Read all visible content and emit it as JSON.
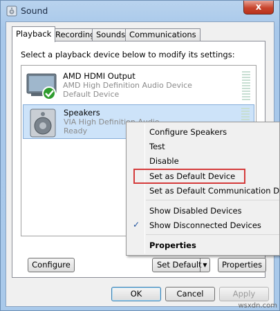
{
  "window": {
    "title": "Sound",
    "close_label": "x"
  },
  "tabs": [
    {
      "label": "Playback",
      "active": true
    },
    {
      "label": "Recording",
      "active": false
    },
    {
      "label": "Sounds",
      "active": false
    },
    {
      "label": "Communications",
      "active": false
    }
  ],
  "instruction": "Select a playback device below to modify its settings:",
  "devices": [
    {
      "name": "AMD HDMI Output",
      "description": "AMD High Definition Audio Device",
      "status": "Default Device",
      "icon": "monitor-icon",
      "default_badge": "check-badge-icon",
      "selected": false
    },
    {
      "name": "Speakers",
      "description": "VIA High Definition Audio",
      "status": "Ready",
      "icon": "speaker-icon",
      "selected": true
    }
  ],
  "panel_buttons": {
    "configure": "Configure",
    "set_default": "Set Default",
    "properties": "Properties"
  },
  "context_menu": {
    "items": [
      {
        "label": "Configure Speakers"
      },
      {
        "label": "Test"
      },
      {
        "label": "Disable"
      },
      {
        "label": "Set as Default Device",
        "highlighted": true
      },
      {
        "label": "Set as Default Communication Device"
      },
      {
        "label": "Show Disabled Devices"
      },
      {
        "label": "Show Disconnected Devices",
        "checked": true
      },
      {
        "label": "Properties",
        "bold": true
      }
    ],
    "check_glyph": "✓"
  },
  "dialog_buttons": {
    "ok": "OK",
    "cancel": "Cancel",
    "apply": "Apply"
  },
  "watermark": "wsxdn.com",
  "colors": {
    "selection": "#cde3f9",
    "highlight_border": "#d43a3a",
    "title_bar": "#b9d3ee"
  }
}
